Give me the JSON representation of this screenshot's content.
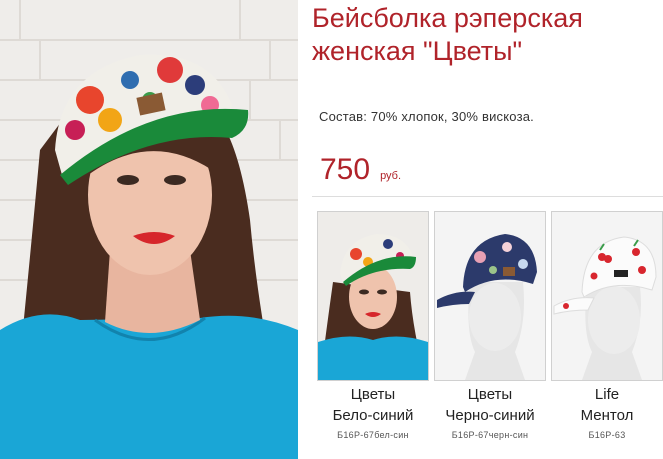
{
  "product": {
    "title_line1": "Бейсболка рэперская",
    "title_line2": "женская \"Цветы\"",
    "composition": "Состав: 70% хлопок, 30% вискоза.",
    "price": "750",
    "currency": "руб."
  },
  "variants": [
    {
      "name_line1": "Цветы",
      "name_line2": "Бело-синий",
      "code": "Б16Р-67бел-син"
    },
    {
      "name_line1": "Цветы",
      "name_line2": "Черно-синий",
      "code": "Б16Р-67черн-син"
    },
    {
      "name_line1": "Life",
      "name_line2": "Ментол",
      "code": "Б16Р-63"
    }
  ],
  "colors": {
    "accent": "#b0232a",
    "brim_green": "#1a8a3a",
    "top_blue": "#1aa6d6"
  }
}
